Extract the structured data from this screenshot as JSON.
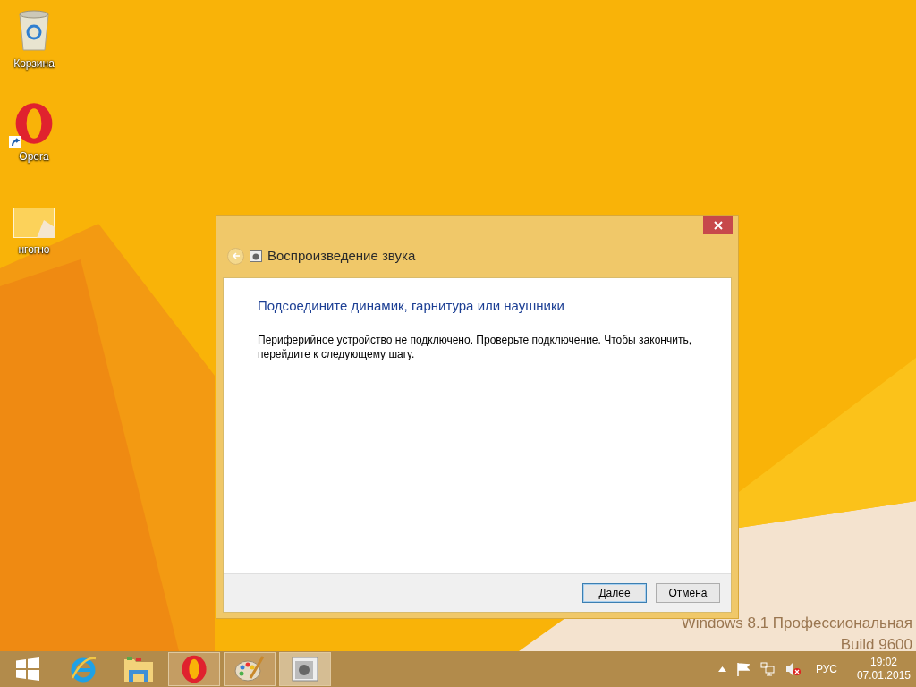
{
  "desktop_icons": [
    {
      "label": "Корзина",
      "kind": "recycle"
    },
    {
      "label": "Opera",
      "kind": "opera"
    },
    {
      "label": "нгогно",
      "kind": "image"
    }
  ],
  "dialog": {
    "title": "Воспроизведение звука",
    "heading": "Подсоедините динамик, гарнитура или наушники",
    "body": "Периферийное устройство не подключено. Проверьте подключение.  Чтобы закончить, перейдите к следующему шагу.",
    "buttons": [
      {
        "label": "Далее",
        "default": true
      },
      {
        "label": "Отмена",
        "default": false
      }
    ]
  },
  "os_edition": [
    "Windows 8.1 Профессиональная",
    "Build 9600"
  ],
  "taskbar": {
    "items": [
      {
        "kind": "start",
        "running": false,
        "active": false
      },
      {
        "kind": "ie",
        "running": false,
        "active": false
      },
      {
        "kind": "explorer",
        "running": false,
        "active": false
      },
      {
        "kind": "opera",
        "running": true,
        "active": false
      },
      {
        "kind": "paint",
        "running": true,
        "active": false
      },
      {
        "kind": "sound",
        "running": true,
        "active": true
      }
    ],
    "language": "РУС",
    "time": "19:02",
    "date": "07.01.2015"
  }
}
